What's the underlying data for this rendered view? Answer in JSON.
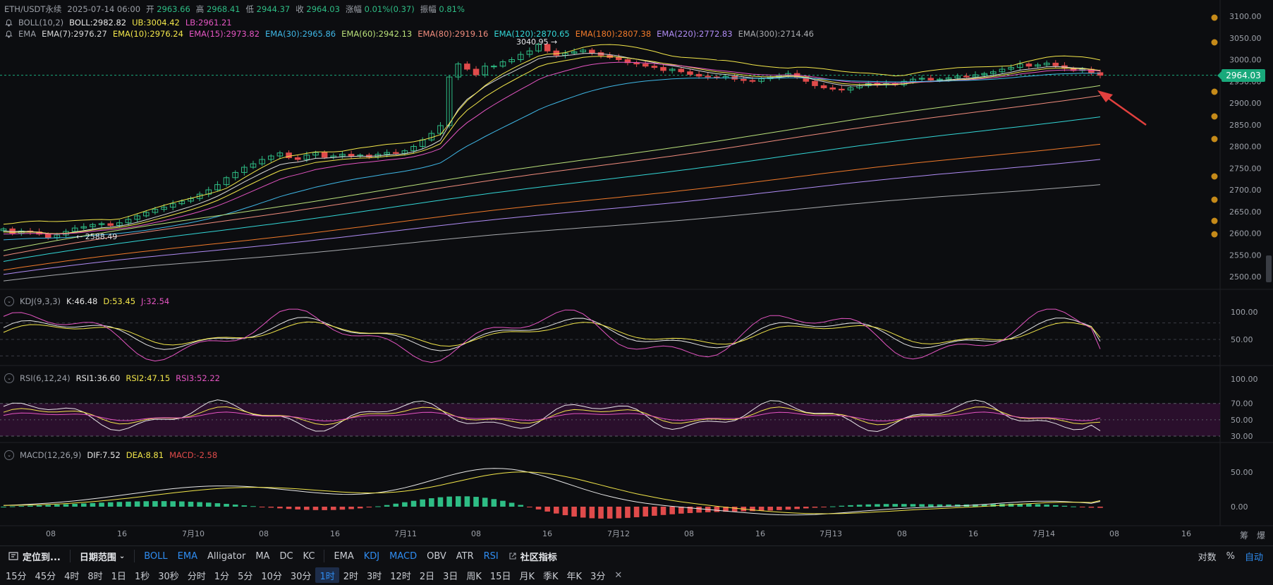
{
  "header": {
    "symbol": "ETH/USDT永续",
    "datetime": "2025-07-14 06:00",
    "open_label": "开",
    "open": "2963.66",
    "high_label": "高",
    "high": "2968.41",
    "low_label": "低",
    "low": "2944.37",
    "close_label": "收",
    "close": "2964.03",
    "change_label": "涨幅",
    "change": "0.01%(0.37)",
    "amp_label": "振幅",
    "amp": "0.81%"
  },
  "boll": {
    "name": "BOLL(10,2)",
    "boll": "BOLL:2982.82",
    "ub": "UB:3004.42",
    "lb": "LB:2961.21"
  },
  "ema": {
    "name": "EMA",
    "items": [
      {
        "text": "EMA(7):2976.27",
        "color": "#d8d8d8"
      },
      {
        "text": "EMA(10):2976.24",
        "color": "#f2e64a"
      },
      {
        "text": "EMA(15):2973.82",
        "color": "#e455c2"
      },
      {
        "text": "EMA(30):2965.86",
        "color": "#3fb7e6"
      },
      {
        "text": "EMA(60):2942.13",
        "color": "#b9e07a"
      },
      {
        "text": "EMA(80):2919.16",
        "color": "#f08c7d"
      },
      {
        "text": "EMA(120):2870.65",
        "color": "#33d6d6"
      },
      {
        "text": "EMA(180):2807.38",
        "color": "#f07a2a"
      },
      {
        "text": "EMA(220):2772.83",
        "color": "#b08cf5"
      },
      {
        "text": "EMA(300):2714.46",
        "color": "#a7a9ad"
      }
    ]
  },
  "kdj": {
    "name": "KDJ(9,3,3)",
    "k": "K:46.48",
    "d": "D:53.45",
    "j": "J:32.54"
  },
  "rsi": {
    "name": "RSI(6,12,24)",
    "rsi1": "RSI1:36.60",
    "rsi2": "RSI2:47.15",
    "rsi3": "RSI3:52.22"
  },
  "macd": {
    "name": "MACD(12,26,9)",
    "dif": "DIF:7.52",
    "dea": "DEA:8.81",
    "macd": "MACD:-2.58"
  },
  "price_badge": "2964.03",
  "annotations": {
    "high_marker": "3040.95 →",
    "low_marker": "← 2588.49"
  },
  "right_axis_top_label": "筹",
  "right_axis_top_label2": "爆",
  "toolbar1": {
    "locate": "定位到...",
    "date_range": "日期范围",
    "overlays": [
      "BOLL",
      "EMA",
      "Alligator",
      "MA",
      "DC",
      "KC"
    ],
    "overlays_active": [
      true,
      true,
      false,
      false,
      false,
      false
    ],
    "subs": [
      "EMA",
      "KDJ",
      "MACD",
      "OBV",
      "ATR",
      "RSI"
    ],
    "subs_active": [
      false,
      true,
      true,
      false,
      false,
      true
    ],
    "community": "社区指标",
    "right": [
      "对数",
      "%",
      "自动"
    ]
  },
  "toolbar2": {
    "intervals": [
      "15分",
      "45分",
      "4时",
      "8时",
      "1日",
      "1秒",
      "30秒",
      "分时",
      "1分",
      "5分",
      "10分",
      "30分",
      "1时",
      "2时",
      "3时",
      "12时",
      "2日",
      "3日",
      "周K",
      "15日",
      "月K",
      "季K",
      "年K",
      "3分"
    ],
    "selected": "1时",
    "close_symbol": "✕"
  },
  "colors": {
    "up": "#2ebd85",
    "down": "#e04b4b",
    "accent": "#2f8cf0"
  },
  "chart_data": [
    {
      "type": "candlestick",
      "title": "ETH/USDT永续 1时",
      "ylim": [
        2470,
        3120
      ],
      "yticks": [
        "3100.00",
        "3050.00",
        "3000.00",
        "2950.00",
        "2900.00",
        "2850.00",
        "2800.00",
        "2750.00",
        "2700.00",
        "2650.00",
        "2600.00",
        "2550.00",
        "2500.00"
      ],
      "xticks": [
        "08",
        "16",
        "7月10",
        "08",
        "16",
        "7月11",
        "08",
        "16",
        "7月12",
        "08",
        "16",
        "7月13",
        "08",
        "16",
        "7月14",
        "08",
        "16"
      ],
      "current_price": 2964.03,
      "high_marker": 3040.95,
      "low_marker": 2588.49,
      "closes": [
        2610,
        2600,
        2605,
        2603,
        2598,
        2590,
        2596,
        2604,
        2612,
        2615,
        2620,
        2622,
        2618,
        2624,
        2632,
        2640,
        2648,
        2655,
        2660,
        2668,
        2674,
        2680,
        2690,
        2700,
        2712,
        2728,
        2740,
        2752,
        2760,
        2770,
        2778,
        2785,
        2774,
        2770,
        2780,
        2786,
        2775,
        2778,
        2782,
        2778,
        2780,
        2776,
        2782,
        2786,
        2784,
        2790,
        2800,
        2815,
        2830,
        2848,
        2960,
        2990,
        2978,
        2965,
        2985,
        2985,
        2995,
        3000,
        3012,
        3020,
        3035,
        3020,
        3010,
        3015,
        3018,
        3022,
        3016,
        3010,
        3005,
        3000,
        2993,
        2990,
        2985,
        2982,
        2975,
        2978,
        2972,
        2966,
        2962,
        2960,
        2958,
        2961,
        2955,
        2952,
        2950,
        2956,
        2960,
        2963,
        2968,
        2960,
        2950,
        2940,
        2935,
        2932,
        2930,
        2935,
        2940,
        2945,
        2942,
        2945,
        2942,
        2950,
        2955,
        2957,
        2953,
        2955,
        2958,
        2962,
        2960,
        2965,
        2968,
        2972,
        2978,
        2982,
        2990,
        2985,
        2988,
        2992,
        2986,
        2980,
        2975,
        2978,
        2970,
        2964
      ]
    },
    {
      "type": "line",
      "title": "KDJ(9,3,3)",
      "series_names": [
        "K",
        "D",
        "J"
      ],
      "yticks": [
        "100.00",
        "50.00"
      ],
      "last": {
        "K": 46.48,
        "D": 53.45,
        "J": 32.54
      }
    },
    {
      "type": "line",
      "title": "RSI(6,12,24)",
      "series_names": [
        "RSI1",
        "RSI2",
        "RSI3"
      ],
      "yticks": [
        "100.00",
        "70.00",
        "50.00",
        "30.00"
      ],
      "band": [
        30,
        70
      ],
      "last": {
        "RSI1": 36.6,
        "RSI2": 47.15,
        "RSI3": 52.22
      }
    },
    {
      "type": "bar",
      "title": "MACD(12,26,9)",
      "series_names": [
        "DIF",
        "DEA",
        "MACD"
      ],
      "yticks": [
        "50.00",
        "0.00"
      ],
      "last": {
        "DIF": 7.52,
        "DEA": 8.81,
        "MACD": -2.58
      }
    }
  ]
}
